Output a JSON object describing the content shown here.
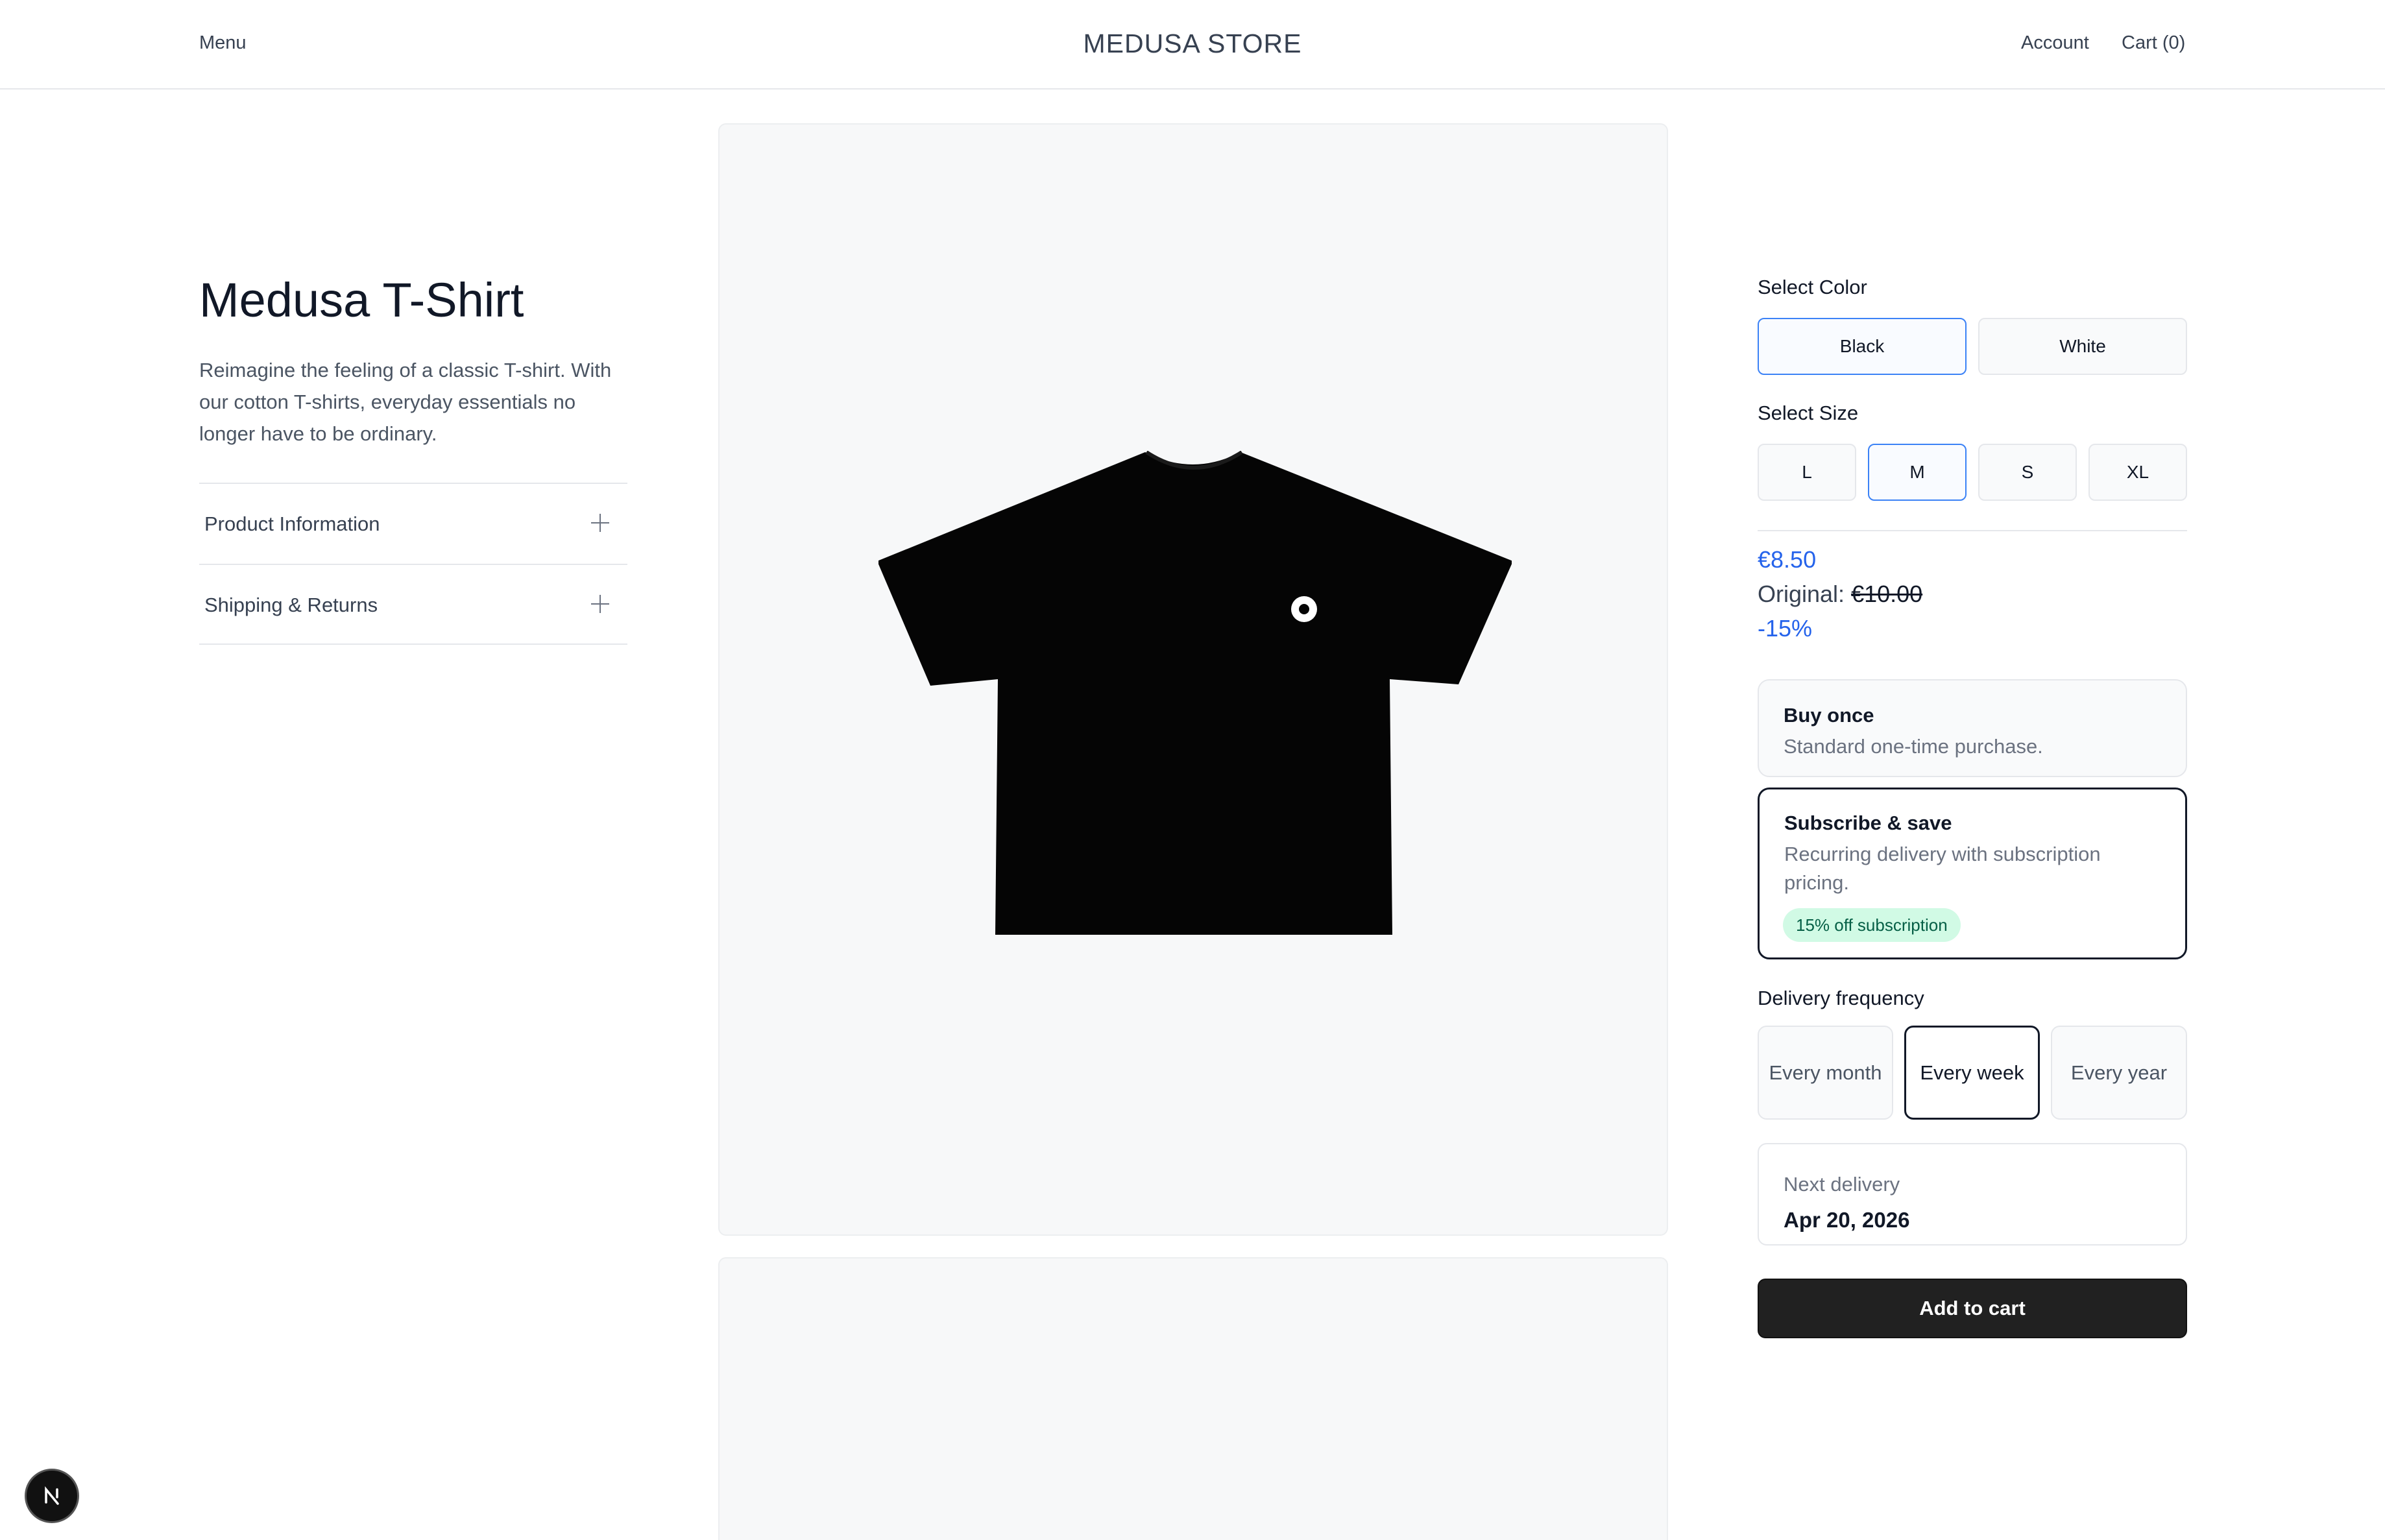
{
  "header": {
    "menu_label": "Menu",
    "store_title": "MEDUSA STORE",
    "account_label": "Account",
    "cart_label": "Cart (0)"
  },
  "product": {
    "title": "Medusa T-Shirt",
    "description": "Reimagine the feeling of a classic T-shirt. With our cotton T-shirts, everyday essentials no longer have to be ordinary.",
    "accordion": [
      {
        "label": "Product Information"
      },
      {
        "label": "Shipping & Returns"
      }
    ]
  },
  "options": {
    "color_label": "Select Color",
    "colors": [
      {
        "label": "Black",
        "selected": true
      },
      {
        "label": "White",
        "selected": false
      }
    ],
    "size_label": "Select Size",
    "sizes": [
      {
        "label": "L",
        "selected": false
      },
      {
        "label": "M",
        "selected": true
      },
      {
        "label": "S",
        "selected": false
      },
      {
        "label": "XL",
        "selected": false
      }
    ]
  },
  "pricing": {
    "price": "€8.50",
    "original_prefix": "Original:",
    "original_price": "€10.00",
    "discount": "-15%"
  },
  "purchase_plans": [
    {
      "title": "Buy once",
      "subtitle": "Standard one-time purchase.",
      "selected": false
    },
    {
      "title": "Subscribe & save",
      "subtitle": "Recurring delivery with subscription pricing.",
      "badge": "15% off subscription",
      "selected": true
    }
  ],
  "delivery": {
    "label": "Delivery frequency",
    "options": [
      {
        "label": "Every month",
        "selected": false
      },
      {
        "label": "Every week",
        "selected": true
      },
      {
        "label": "Every year",
        "selected": false
      }
    ],
    "next_label": "Next delivery",
    "next_date": "Apr 20, 2026"
  },
  "add_to_cart_label": "Add to cart",
  "dev_badge_letter": "N",
  "colors": {
    "accent": "#2563eb",
    "selected_border": "#3b82f6",
    "button_dark": "#212121",
    "badge_bg": "#d1fae5",
    "badge_text": "#065f46"
  }
}
